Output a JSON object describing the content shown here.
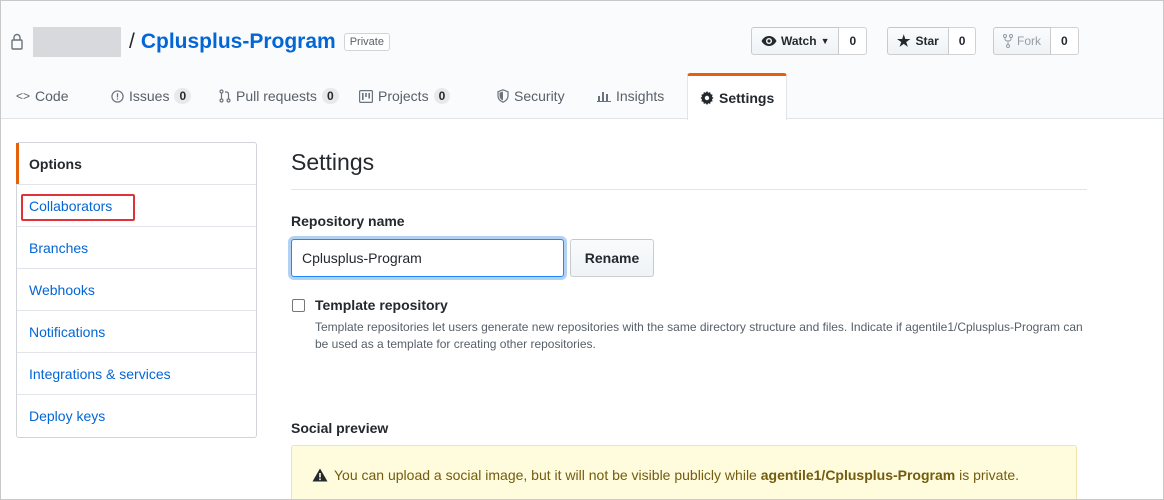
{
  "repo": {
    "separator": "/",
    "name": "Cplusplus-Program",
    "visibility": "Private"
  },
  "actions": {
    "watch": {
      "label": "Watch",
      "count": "0"
    },
    "star": {
      "label": "Star",
      "count": "0"
    },
    "fork": {
      "label": "Fork",
      "count": "0"
    }
  },
  "tabs": [
    {
      "label": "Code",
      "icon": "code-icon"
    },
    {
      "label": "Issues",
      "count": "0",
      "icon": "issue-icon"
    },
    {
      "label": "Pull requests",
      "count": "0",
      "icon": "pull-request-icon"
    },
    {
      "label": "Projects",
      "count": "0",
      "icon": "project-icon"
    },
    {
      "label": "Security",
      "icon": "shield-icon"
    },
    {
      "label": "Insights",
      "icon": "graph-icon"
    },
    {
      "label": "Settings",
      "icon": "gear-icon",
      "selected": true
    }
  ],
  "sidebar": {
    "items": [
      {
        "label": "Options"
      },
      {
        "label": "Collaborators"
      },
      {
        "label": "Branches"
      },
      {
        "label": "Webhooks"
      },
      {
        "label": "Notifications"
      },
      {
        "label": "Integrations & services"
      },
      {
        "label": "Deploy keys"
      }
    ]
  },
  "settings": {
    "title": "Settings",
    "repository_name_label": "Repository name",
    "repository_name_value": "Cplusplus-Program",
    "rename_label": "Rename",
    "template_label": "Template repository",
    "template_note": "Template repositories let users generate new repositories with the same directory structure and files. Indicate if agentile1/Cplusplus-Program can be used as a template for creating other repositories.",
    "social_preview_label": "Social preview",
    "flash_prefix": "You can upload a social image, but it will not be visible publicly while ",
    "flash_repo": "agentile1/Cplusplus-Program",
    "flash_suffix": " is private."
  },
  "colors": {
    "link": "#0366d6",
    "accent_tab": "#e36209",
    "highlight_box": "#e0323a",
    "flash_bg": "#fffbdd"
  }
}
